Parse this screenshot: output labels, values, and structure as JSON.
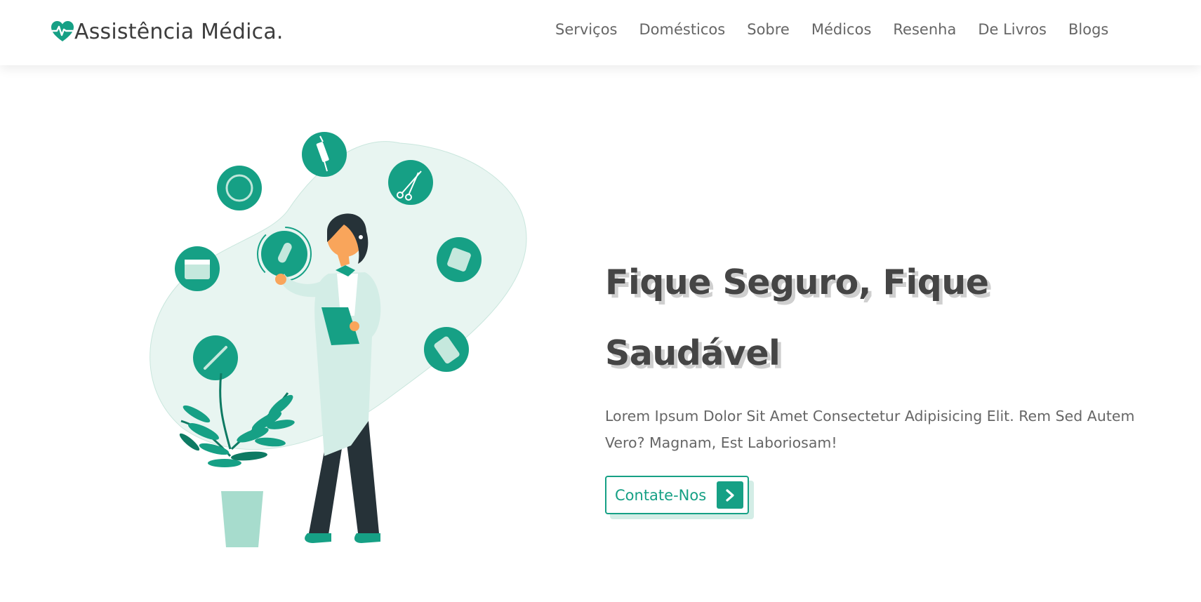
{
  "header": {
    "logo_text": "Assistência Médica.",
    "nav": [
      "Serviços",
      "Domésticos",
      "Sobre",
      "Médicos",
      "Resenha",
      "De Livros",
      "Blogs"
    ]
  },
  "hero": {
    "title_line1": "Fique Seguro, Fique",
    "title_line2": "Saudável",
    "description": "Lorem Ipsum Dolor Sit Amet Consectetur Adipisicing Elit. Rem Sed Autem Vero? Magnam, Est Laboriosam!",
    "cta_label": "Contate-Nos"
  },
  "colors": {
    "accent": "#16a085",
    "text": "#444444",
    "light_accent": "#e8f5f1"
  },
  "icons": [
    "heartbeat-icon",
    "chevron-right-icon",
    "syringe-icon",
    "scissors-icon",
    "ring-icon",
    "calendar-icon",
    "test-tube-icon",
    "bandage-icon",
    "pill-blister-icon",
    "thermometer-icon"
  ]
}
